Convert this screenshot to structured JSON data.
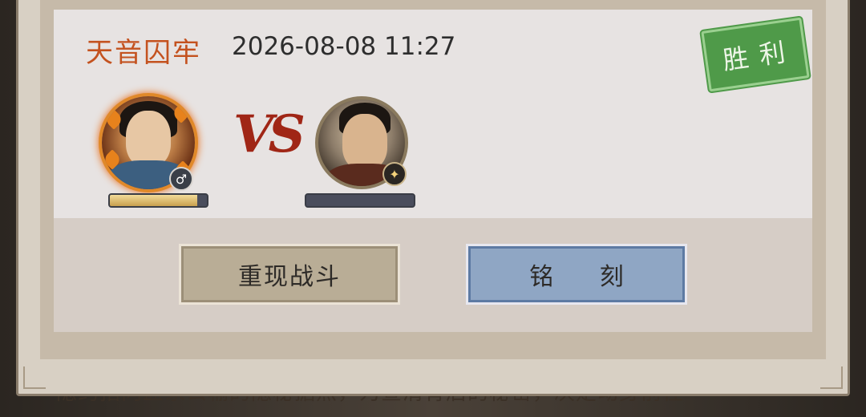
{
  "battle": {
    "title": "天音囚牢",
    "datetime": "2026-08-08 11:27",
    "result": "胜利",
    "vs_text": "VS"
  },
  "players": [
    {
      "gender_symbol": "♂",
      "progress": 0.9
    },
    {
      "badge_icon": "eagle-emblem-icon",
      "progress": 0.0
    }
  ],
  "buttons": {
    "replay": "重现战斗",
    "engrave": "铭 刻"
  },
  "background_text": "隐约指向血家公输的隐秘据点，为查清背后的秘密，决定动身前往"
}
